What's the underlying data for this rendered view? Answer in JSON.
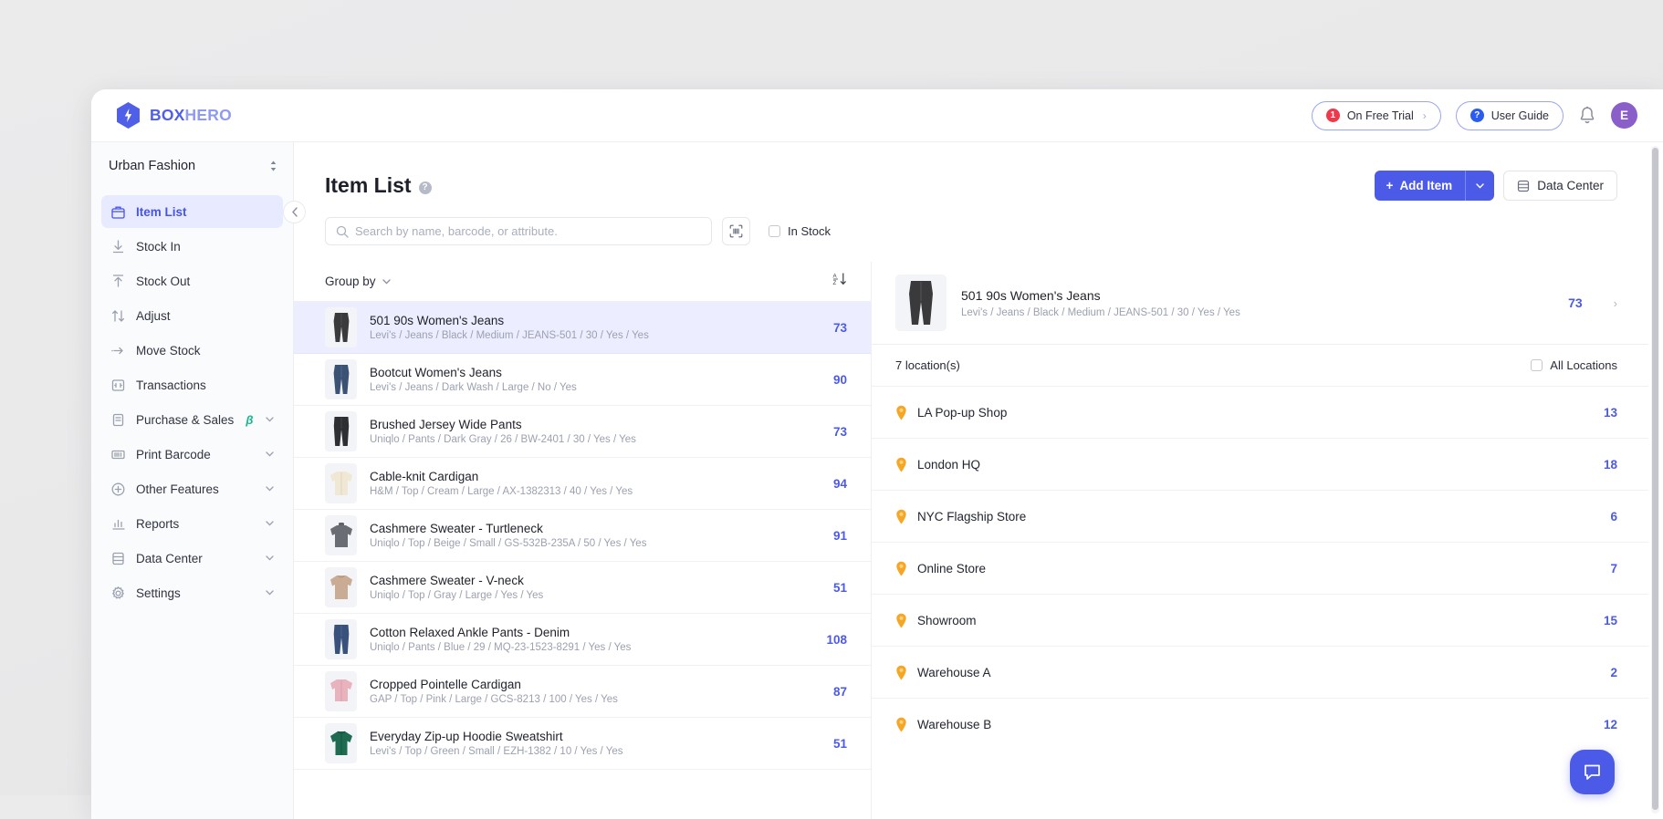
{
  "brand": {
    "name_bold": "BOX",
    "name_light": "HERO",
    "accent": "#4f5fe8"
  },
  "topbar": {
    "trial_badge": "1",
    "trial_label": "On Free Trial",
    "trial_chevron": "›",
    "guide_badge": "?",
    "guide_label": "User Guide",
    "bell_icon": "bell-icon",
    "avatar_initial": "E"
  },
  "sidebar": {
    "workspace": "Urban Fashion",
    "items": [
      {
        "label": "Item List",
        "icon": "box-icon",
        "active": true,
        "caret": false,
        "beta": false
      },
      {
        "label": "Stock In",
        "icon": "arrow-down-icon",
        "active": false,
        "caret": false,
        "beta": false
      },
      {
        "label": "Stock Out",
        "icon": "arrow-up-icon",
        "active": false,
        "caret": false,
        "beta": false
      },
      {
        "label": "Adjust",
        "icon": "updown-arrow-icon",
        "active": false,
        "caret": false,
        "beta": false
      },
      {
        "label": "Move Stock",
        "icon": "move-arrow-icon",
        "active": false,
        "caret": false,
        "beta": false
      },
      {
        "label": "Transactions",
        "icon": "receipt-icon",
        "active": false,
        "caret": false,
        "beta": false
      },
      {
        "label": "Purchase & Sales",
        "icon": "document-icon",
        "active": false,
        "caret": true,
        "beta": true
      },
      {
        "label": "Print Barcode",
        "icon": "barcode-icon",
        "active": false,
        "caret": true,
        "beta": false
      },
      {
        "label": "Other Features",
        "icon": "plus-circle-icon",
        "active": false,
        "caret": true,
        "beta": false
      },
      {
        "label": "Reports",
        "icon": "bar-chart-icon",
        "active": false,
        "caret": true,
        "beta": false
      },
      {
        "label": "Data Center",
        "icon": "database-icon",
        "active": false,
        "caret": true,
        "beta": false
      },
      {
        "label": "Settings",
        "icon": "gear-icon",
        "active": false,
        "caret": true,
        "beta": false
      }
    ],
    "beta_symbol": "β",
    "collapse_icon": "chevron-left-icon"
  },
  "page": {
    "title": "Item List",
    "help_icon_label": "?",
    "add_item_label": "Add Item",
    "add_item_plus": "+",
    "data_center_label": "Data Center"
  },
  "search": {
    "placeholder": "Search by name, barcode, or attribute.",
    "value": "",
    "barcode_icon": "barcode-scan-icon",
    "in_stock_label": "In Stock",
    "in_stock_checked": false
  },
  "list": {
    "group_by_label": "Group by",
    "sort_icon": "sort-az-icon",
    "items": [
      {
        "name": "501 90s Women's Jeans",
        "attrs": "Levi's / Jeans / Black / Medium / JEANS-501 / 30 / Yes / Yes",
        "qty": "73",
        "selected": true,
        "thumb": "black-jeans"
      },
      {
        "name": "Bootcut Women's Jeans",
        "attrs": "Levi's / Jeans / Dark Wash / Large / No / Yes",
        "qty": "90",
        "selected": false,
        "thumb": "blue-jeans"
      },
      {
        "name": "Brushed Jersey Wide Pants",
        "attrs": "Uniqlo / Pants / Dark Gray / 26 / BW-2401 / 30 / Yes / Yes",
        "qty": "73",
        "selected": false,
        "thumb": "dark-pants"
      },
      {
        "name": "Cable-knit Cardigan",
        "attrs": "H&M / Top / Cream / Large / AX-1382313 / 40 / Yes / Yes",
        "qty": "94",
        "selected": false,
        "thumb": "cream-cardigan"
      },
      {
        "name": "Cashmere Sweater - Turtleneck",
        "attrs": "Uniqlo / Top / Beige / Small / GS-532B-235A / 50 / Yes / Yes",
        "qty": "91",
        "selected": false,
        "thumb": "gray-turtleneck"
      },
      {
        "name": "Cashmere Sweater - V-neck",
        "attrs": "Uniqlo / Top / Gray / Large / Yes / Yes",
        "qty": "51",
        "selected": false,
        "thumb": "beige-sweater"
      },
      {
        "name": "Cotton Relaxed Ankle Pants - Denim",
        "attrs": "Uniqlo / Pants / Blue / 29 / MQ-23-1523-8291 / Yes / Yes",
        "qty": "108",
        "selected": false,
        "thumb": "blue-pants"
      },
      {
        "name": "Cropped Pointelle Cardigan",
        "attrs": "GAP / Top / Pink / Large / GCS-8213 / 100 / Yes / Yes",
        "qty": "87",
        "selected": false,
        "thumb": "pink-cardigan"
      },
      {
        "name": "Everyday Zip-up Hoodie Sweatshirt",
        "attrs": "Levi's / Top / Green / Small / EZH-1382 / 10 / Yes / Yes",
        "qty": "51",
        "selected": false,
        "thumb": "green-hoodie"
      }
    ]
  },
  "detail": {
    "name": "501 90s Women's Jeans",
    "attrs": "Levi's / Jeans / Black / Medium / JEANS-501 / 30 / Yes / Yes",
    "qty": "73",
    "arrow": "›",
    "locations_count_label": "7 location(s)",
    "all_locations_label": "All Locations",
    "all_locations_checked": false,
    "locations": [
      {
        "name": "LA Pop-up Shop",
        "qty": "13"
      },
      {
        "name": "London HQ",
        "qty": "18"
      },
      {
        "name": "NYC Flagship Store",
        "qty": "6"
      },
      {
        "name": "Online Store",
        "qty": "7"
      },
      {
        "name": "Showroom",
        "qty": "15"
      },
      {
        "name": "Warehouse A",
        "qty": "2"
      },
      {
        "name": "Warehouse B",
        "qty": "12"
      }
    ]
  },
  "chat": {
    "icon": "chat-bubble-icon"
  },
  "colors": {
    "accent_blue": "#4c5ae8",
    "selected_row_bg": "#eceeff",
    "qty_blue": "#4c5ae8",
    "pin_orange": "#f5a623",
    "badge_red": "#f0384a",
    "avatar_purple": "#8b5fc9",
    "beta_green": "#17b890"
  }
}
